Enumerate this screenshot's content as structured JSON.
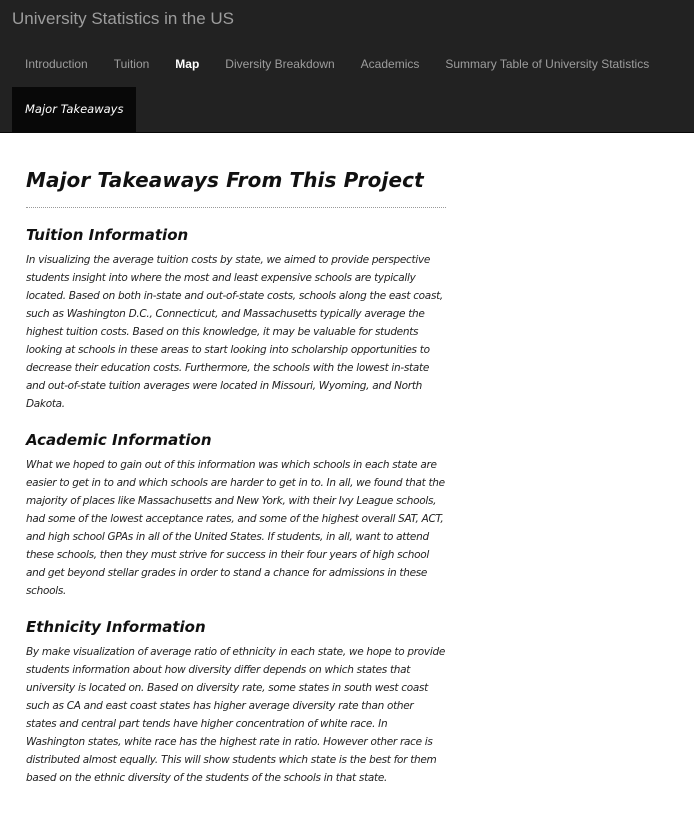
{
  "header": {
    "brand": "University Statistics in the US"
  },
  "nav": {
    "items": [
      {
        "label": "Introduction"
      },
      {
        "label": "Tuition"
      },
      {
        "label": "Map"
      },
      {
        "label": "Diversity Breakdown"
      },
      {
        "label": "Academics"
      },
      {
        "label": "Summary Table of University Statistics"
      }
    ],
    "active": "Map",
    "second_row_item": "Major Takeaways"
  },
  "main": {
    "title": "Major Takeaways From This Project",
    "sections": [
      {
        "title": "Tuition Information",
        "text": "In visualizing the average tuition costs by state, we aimed to provide perspective students insight into where the most and least expensive schools are typically located. Based on both in-state and out-of-state costs, schools along the east coast, such as Washington D.C., Connecticut, and Massachusetts typically average the highest tuition costs. Based on this knowledge, it may be valuable for students looking at schools in these areas to start looking into scholarship opportunities to decrease their education costs. Furthermore, the schools with the lowest in-state and out-of-state tuition averages were located in Missouri, Wyoming, and North Dakota."
      },
      {
        "title": "Academic Information",
        "text": "What we hoped to gain out of this information was which schools in each state are easier to get in to and which schools are harder to get in to. In all, we found that the majority of places like Massachusetts and New York, with their Ivy League schools, had some of the lowest acceptance rates, and some of the highest overall SAT, ACT, and high school GPAs in all of the United States. If students, in all, want to attend these schools, then they must strive for success in their four years of high school and get beyond stellar grades in order to stand a chance for admissions in these schools."
      },
      {
        "title": "Ethnicity Information",
        "text": "By make visualization of average ratio of ethnicity in each state, we hope to provide students information about how diversity differ depends on which states that university is located on. Based on diversity rate, some states in south west coast such as CA and east coast states has higher average diversity rate than other states and central part tends have higher concentration of white race. In Washington states, white race has the highest rate in ratio. However other race is distributed almost equally. This will show students which state is the best for them based on the ethnic diversity of the students of the schools in that state."
      }
    ]
  }
}
